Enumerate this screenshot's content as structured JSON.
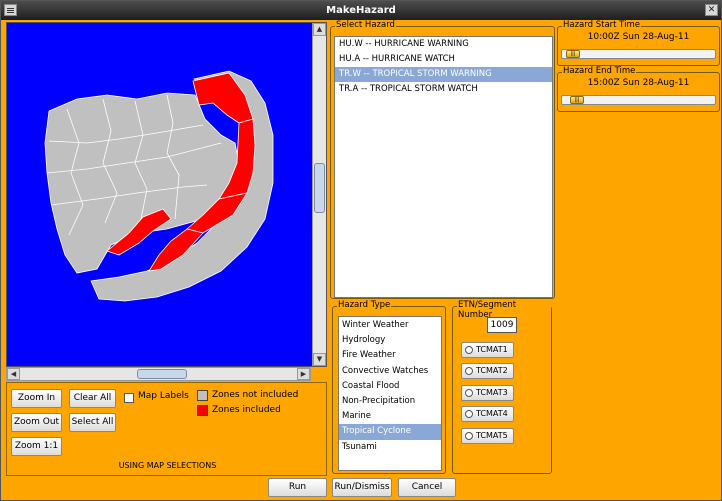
{
  "window": {
    "title": "MakeHazard",
    "close_glyph": "✕"
  },
  "map": {
    "controls": {
      "zoom_in": "Zoom In",
      "zoom_out": "Zoom Out",
      "zoom_1_1": "Zoom 1:1",
      "clear_all": "Clear All",
      "select_all": "Select All",
      "map_labels": "Map Labels",
      "map_labels_checked": false
    },
    "legend": [
      {
        "label": "Zones not included",
        "color": "#C0C0C0"
      },
      {
        "label": "Zones included",
        "color": "#FF0000"
      }
    ],
    "status": "USING MAP SELECTIONS",
    "colors": {
      "background": "#0000FF",
      "not_included": "#C0C0C0",
      "included": "#FF0000"
    }
  },
  "select_hazard": {
    "title": "Select Hazard",
    "items": [
      {
        "label": "HU.W -- HURRICANE WARNING",
        "selected": false
      },
      {
        "label": "HU.A -- HURRICANE WATCH",
        "selected": false
      },
      {
        "label": "TR.W -- TROPICAL STORM WARNING",
        "selected": true
      },
      {
        "label": "TR.A -- TROPICAL STORM WATCH",
        "selected": false
      }
    ]
  },
  "hazard_type": {
    "title": "Hazard Type",
    "items": [
      {
        "label": "Winter Weather",
        "selected": false
      },
      {
        "label": "Hydrology",
        "selected": false
      },
      {
        "label": "Fire Weather",
        "selected": false
      },
      {
        "label": "Convective Watches",
        "selected": false
      },
      {
        "label": "Coastal Flood",
        "selected": false
      },
      {
        "label": "Non-Precipitation",
        "selected": false
      },
      {
        "label": "Marine",
        "selected": false
      },
      {
        "label": "Tropical Cyclone",
        "selected": true
      },
      {
        "label": "Tsunami",
        "selected": false
      }
    ]
  },
  "etn": {
    "title": "ETN/Segment Number",
    "value": "1009",
    "options": [
      "TCMAT1",
      "TCMAT2",
      "TCMAT3",
      "TCMAT4",
      "TCMAT5"
    ]
  },
  "start_time": {
    "title": "Hazard Start Time",
    "value": "10:00Z Sun 28-Aug-11",
    "slider_position": 0.03
  },
  "end_time": {
    "title": "Hazard End Time",
    "value": "15:00Z Sun 28-Aug-11",
    "slider_position": 0.06
  },
  "actions": {
    "run": "Run",
    "run_dismiss": "Run/Dismiss",
    "cancel": "Cancel"
  },
  "accent": {
    "window_bg": "#FFA500",
    "selection": "#8AA8D6"
  }
}
